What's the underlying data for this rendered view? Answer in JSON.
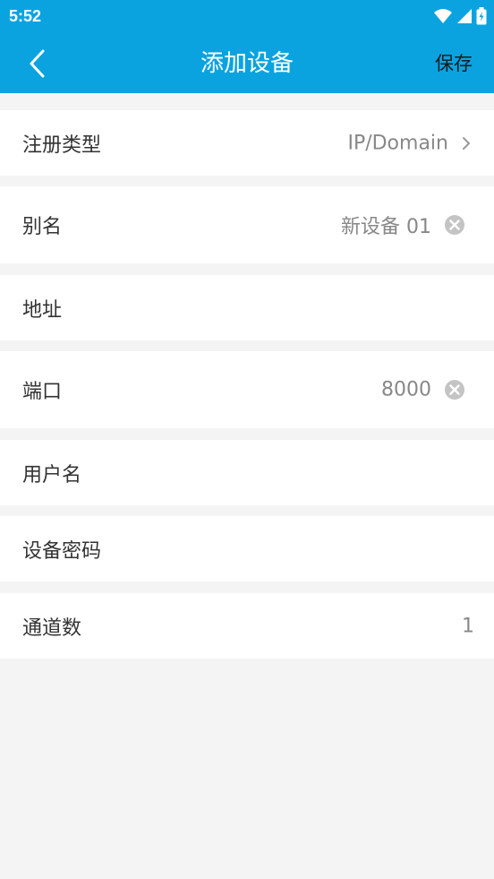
{
  "status_bar": {
    "time": "5:52",
    "icons": [
      "wifi-icon",
      "cell-signal-icon",
      "battery-icon"
    ]
  },
  "app_bar": {
    "title": "添加设备",
    "back_icon": "chevron-left-icon",
    "save_label": "保存",
    "background_color": "#0aa3e0"
  },
  "form": {
    "register_type": {
      "label": "注册类型",
      "value": "IP/Domain",
      "icon": "chevron-right-icon"
    },
    "alias": {
      "label": "别名",
      "value": "新设备 01",
      "icon": "clear-icon"
    },
    "address": {
      "label": "地址",
      "value": ""
    },
    "port": {
      "label": "端口",
      "value": "8000",
      "icon": "clear-icon"
    },
    "username": {
      "label": "用户名",
      "value": ""
    },
    "password": {
      "label": "设备密码",
      "value": ""
    },
    "channels": {
      "label": "通道数",
      "value": "1"
    }
  }
}
